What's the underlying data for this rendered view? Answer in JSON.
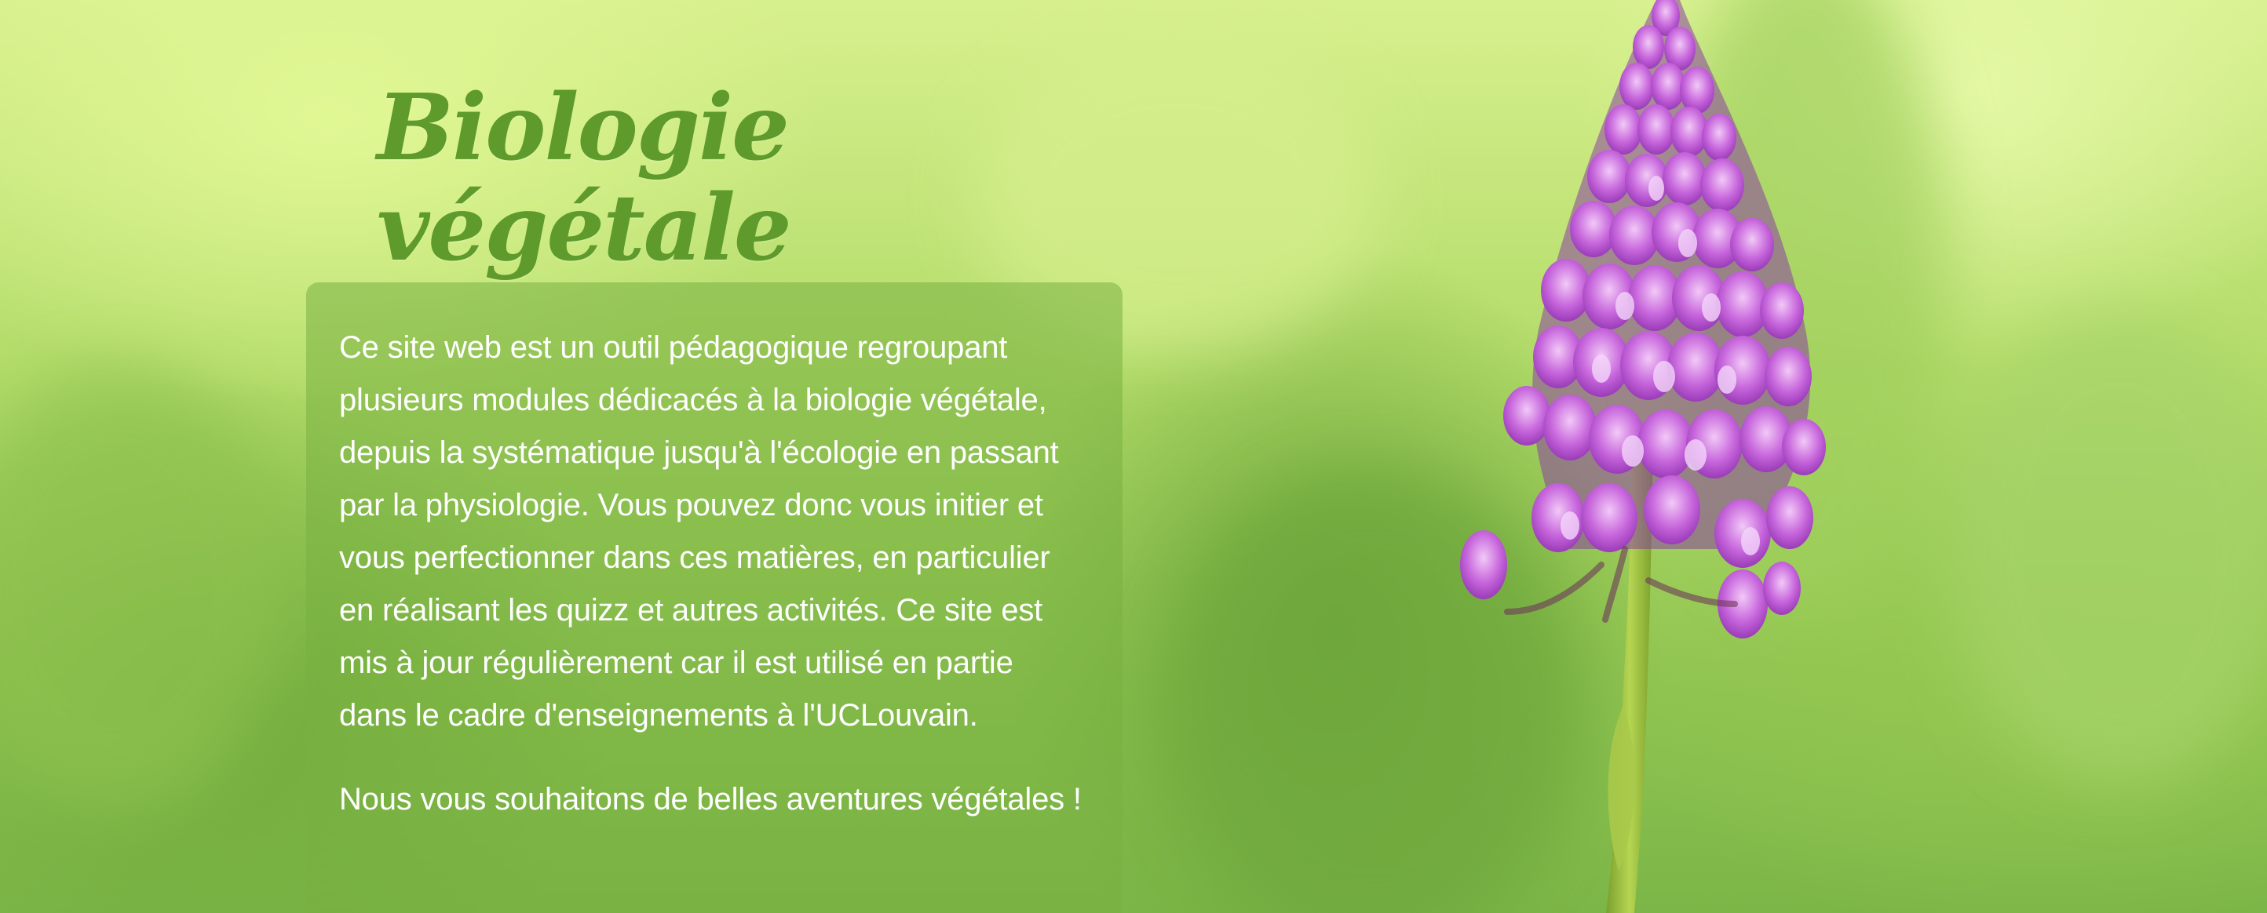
{
  "hero": {
    "title": "Biologie végétale",
    "intro": "Ce site web est un outil pédagogique regroupant plusieurs modules dédicacés à la biologie végétale, depuis la systématique jusqu'à l'écologie en passant par la physiologie. Vous pouvez donc vous initier et vous perfectionner dans ces matières, en particulier en réalisant les quizz et autres activités. Ce site est mis à jour régulièrement car il est utilisé en partie dans le cadre d'enseignements à l'UCLouvain.",
    "closing": "Nous vous souhaitons de belles aventures végétales !"
  },
  "image": {
    "subject": "pyramidal-orchid-flower",
    "colors": {
      "title_green": "#5e9a2c",
      "flower_purple": "#b44fd0",
      "stem_green": "#8fb83a"
    }
  }
}
